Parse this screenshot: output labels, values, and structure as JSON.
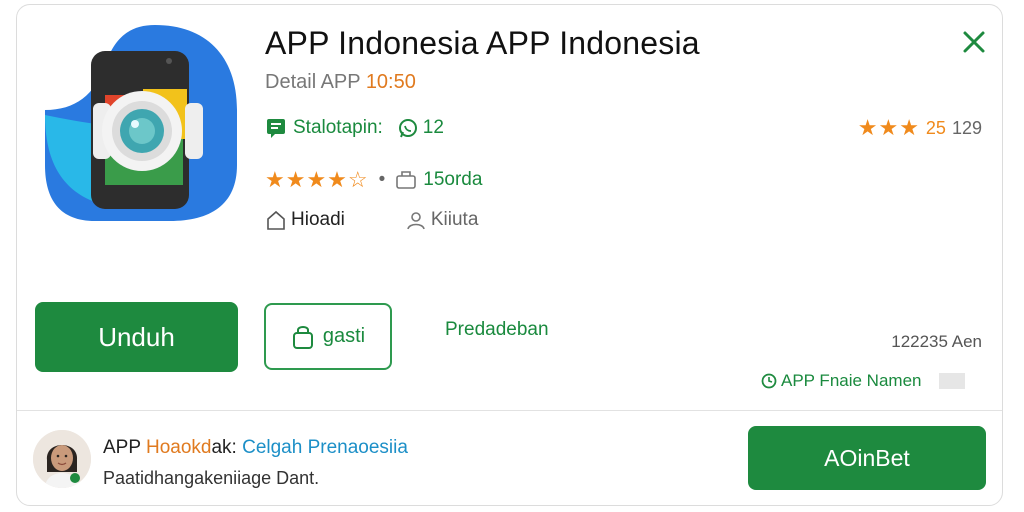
{
  "app": {
    "title": "APP Indonesia  APP Indonesia",
    "subtitle_prefix": "Detail APP",
    "subtitle_time": "10:50",
    "developer_label": "Stalotapin:",
    "badge_count": "12",
    "rating_stars": "★★★★☆",
    "rating_bullet": "•",
    "downloads": "15orda",
    "meta_left": "Hioadi",
    "meta_right": "Kiiuta",
    "right_stars": "★★★",
    "right_score": "25",
    "right_count": "129"
  },
  "actions": {
    "primary": "Unduh",
    "secondary": "gasti",
    "link": "Predadeban",
    "size_info": "122235 Aen",
    "name_info": "APP Fnaie Namen"
  },
  "promo": {
    "title_prefix": "APP",
    "title_highlight": "Hoaokd",
    "title_mid": "ak:",
    "title_blue": "Celgah Prenaoesiia",
    "subtitle": "Paatidhangakeniiage Dant.",
    "button": "AOinBet"
  },
  "icons": [
    "app-camera-icon",
    "close-icon",
    "chat-icon",
    "whatsapp-icon",
    "box-icon",
    "home-icon",
    "person-icon",
    "bag-icon",
    "clock-icon"
  ],
  "colors": {
    "green": "#1e8a3f",
    "orange": "#f08a1c",
    "blue": "#1c8fc7"
  }
}
